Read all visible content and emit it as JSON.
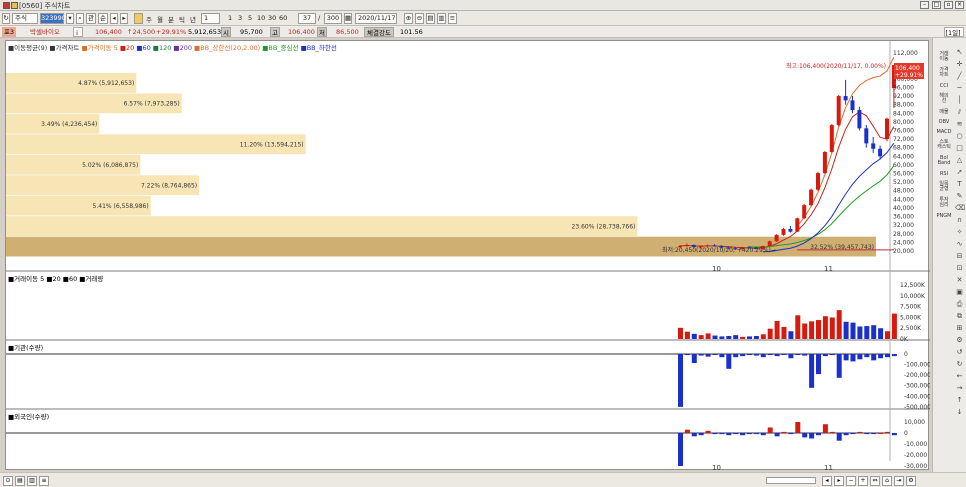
{
  "window": {
    "title": "[0560] 주식차트",
    "menu_label": "[1일]"
  },
  "toolbar": {
    "market": "주식",
    "code": "323990",
    "code_btns": [
      "관",
      "순"
    ],
    "periods": [
      "주",
      "월",
      "분",
      "틱",
      "년"
    ],
    "minute_value": "1",
    "minute_options": [
      "1",
      "3",
      "5",
      "10",
      "30",
      "60"
    ],
    "count_value": "37",
    "total_value": "300",
    "date_value": "2020/11/17"
  },
  "pricebar": {
    "tag": "포3",
    "stock_name": "박셀바이오",
    "price": "106,400",
    "change": "↑24,500",
    "change_pct": "+29.91%",
    "volume": "5,912,653",
    "open_label": "시",
    "open": "95,700",
    "high_label": "고",
    "high": "106,400",
    "low_label": "저",
    "low": "86,500",
    "strength_label": "체결강도",
    "strength": "101.56"
  },
  "colors": {
    "up": "#d81a0e",
    "down": "#1b2fcb",
    "ma5": "#d9702a",
    "ma20": "#1f9d1f",
    "ma60": "#1b7a3a",
    "ma120": "#6a2ea8",
    "band_upper": "#e36b2c",
    "band_lower": "#c5283b",
    "profile": "#f7e5b5",
    "profile_dark": "#c8a15a"
  },
  "price_panel": {
    "legend": [
      "■이동평균(9)",
      "■가격차트",
      "■가격이동 5",
      "■20",
      "■60",
      "■120",
      "■200",
      "■BB_상한선(20,2.00)",
      "■BB_중심선",
      "■BB_하한선"
    ],
    "y_ticks": [
      "112,000",
      "104,000",
      "100,000",
      "96,000",
      "92,000",
      "88,000",
      "84,000",
      "80,000",
      "76,000",
      "72,000",
      "68,000",
      "64,000",
      "60,000",
      "56,000",
      "52,000",
      "48,000",
      "44,000",
      "40,000",
      "36,000",
      "32,000",
      "28,000",
      "24,000",
      "20,000"
    ],
    "high_note": "최고:106,400(2020/11/17, 0.00%)",
    "low_note": "최저:20,450(2020/10/20, +420.29%)→",
    "price_tag_1": "106,400",
    "price_tag_2": "+29.91%",
    "x_labels": [
      "10",
      "11"
    ],
    "profile": [
      {
        "label": "4.87% (5,912,653)",
        "pct": 4.87
      },
      {
        "label": "6.57% (7,973,285)",
        "pct": 6.57
      },
      {
        "label": "3.49% (4,236,454)",
        "pct": 3.49
      },
      {
        "label": "11.20% (13,594,215)",
        "pct": 11.2
      },
      {
        "label": "5.02% (6,086,875)",
        "pct": 5.02
      },
      {
        "label": "7.22% (8,764,865)",
        "pct": 7.22
      },
      {
        "label": "5.41% (6,558,986)",
        "pct": 5.41
      },
      {
        "label": "23.60% (28,738,766)",
        "pct": 23.6
      },
      {
        "label": "32.52% (39,457,743)",
        "pct": 32.52
      }
    ]
  },
  "volume_panel": {
    "legend": "■거래이동 5 ■20 ■60 ■거래량",
    "y_ticks": [
      "12,500K",
      "10,000K",
      "7,500K",
      "5,000K",
      "2,500K",
      "0K"
    ]
  },
  "inst_panel": {
    "legend": "■기관(수량)",
    "y_ticks": [
      "0",
      "-100,000",
      "-200,000",
      "-300,000",
      "-400,000",
      "-500,000"
    ]
  },
  "foreign_panel": {
    "legend": "■외국인(수량)",
    "y_ticks": [
      "10,000",
      "0",
      "-10,000",
      "-20,000",
      "-30,000"
    ],
    "x_labels": [
      "10",
      "11"
    ]
  },
  "candles": [
    [
      21800,
      22800,
      21400,
      22300
    ],
    [
      22300,
      23500,
      22000,
      22800
    ],
    [
      22800,
      23100,
      21600,
      21900
    ],
    [
      21900,
      22500,
      21100,
      22200
    ],
    [
      22200,
      23000,
      21900,
      22600
    ],
    [
      22600,
      23200,
      22100,
      22400
    ],
    [
      22400,
      22700,
      21300,
      21600
    ],
    [
      21600,
      22100,
      21000,
      21300
    ],
    [
      21300,
      21900,
      20450,
      20900
    ],
    [
      20900,
      22000,
      20700,
      21700
    ],
    [
      21700,
      22300,
      21200,
      21500
    ],
    [
      21500,
      21800,
      20800,
      21000
    ],
    [
      21000,
      22500,
      20900,
      22300
    ],
    [
      22300,
      24800,
      22100,
      24500
    ],
    [
      24500,
      27800,
      24300,
      27500
    ],
    [
      27500,
      30800,
      27100,
      30200
    ],
    [
      30200,
      31600,
      28600,
      29000
    ],
    [
      29000,
      35500,
      28800,
      35200
    ],
    [
      35200,
      41800,
      34900,
      41300
    ],
    [
      41300,
      49000,
      40800,
      48500
    ],
    [
      48500,
      56800,
      47900,
      56200
    ],
    [
      56200,
      66500,
      55800,
      66000
    ],
    [
      66000,
      79000,
      65500,
      78500
    ],
    [
      78500,
      92500,
      77800,
      92000
    ],
    [
      92000,
      99500,
      88000,
      90000
    ],
    [
      90000,
      92000,
      84000,
      85500
    ],
    [
      85500,
      87000,
      76000,
      77000
    ],
    [
      77000,
      78500,
      68000,
      70000
    ],
    [
      70000,
      73000,
      65500,
      67500
    ],
    [
      67500,
      69000,
      62500,
      64000
    ],
    [
      72000,
      82000,
      71000,
      81500
    ],
    [
      95700,
      106400,
      86500,
      106400
    ]
  ],
  "volume": [
    2.6,
    1.7,
    1.2,
    0.9,
    1.3,
    0.8,
    0.6,
    0.7,
    0.9,
    0.5,
    0.6,
    0.7,
    1.1,
    2.4,
    4.2,
    2.8,
    1.8,
    5.5,
    3.6,
    4.1,
    4.4,
    5.3,
    5.0,
    6.7,
    4.0,
    3.8,
    2.9,
    3.0,
    3.2,
    2.5,
    1.8,
    5.9
  ],
  "inst": [
    -500,
    -10,
    -85,
    -15,
    -25,
    -8,
    -30,
    -140,
    -30,
    -20,
    -10,
    -15,
    -30,
    -10,
    -20,
    -5,
    -40,
    -10,
    -15,
    -320,
    -190,
    -20,
    -10,
    -225,
    -60,
    -70,
    -50,
    -30,
    -60,
    -40,
    -30,
    -20
  ],
  "foreign": [
    -30,
    3,
    -3,
    -2,
    2,
    -1,
    -1,
    -2,
    -1,
    -2,
    -1,
    -1,
    -2,
    5,
    -3,
    1,
    -1,
    10,
    -4,
    -5,
    -2,
    8,
    1,
    -7,
    -2,
    -1,
    1,
    -1,
    -1,
    0,
    1,
    -2
  ]
}
